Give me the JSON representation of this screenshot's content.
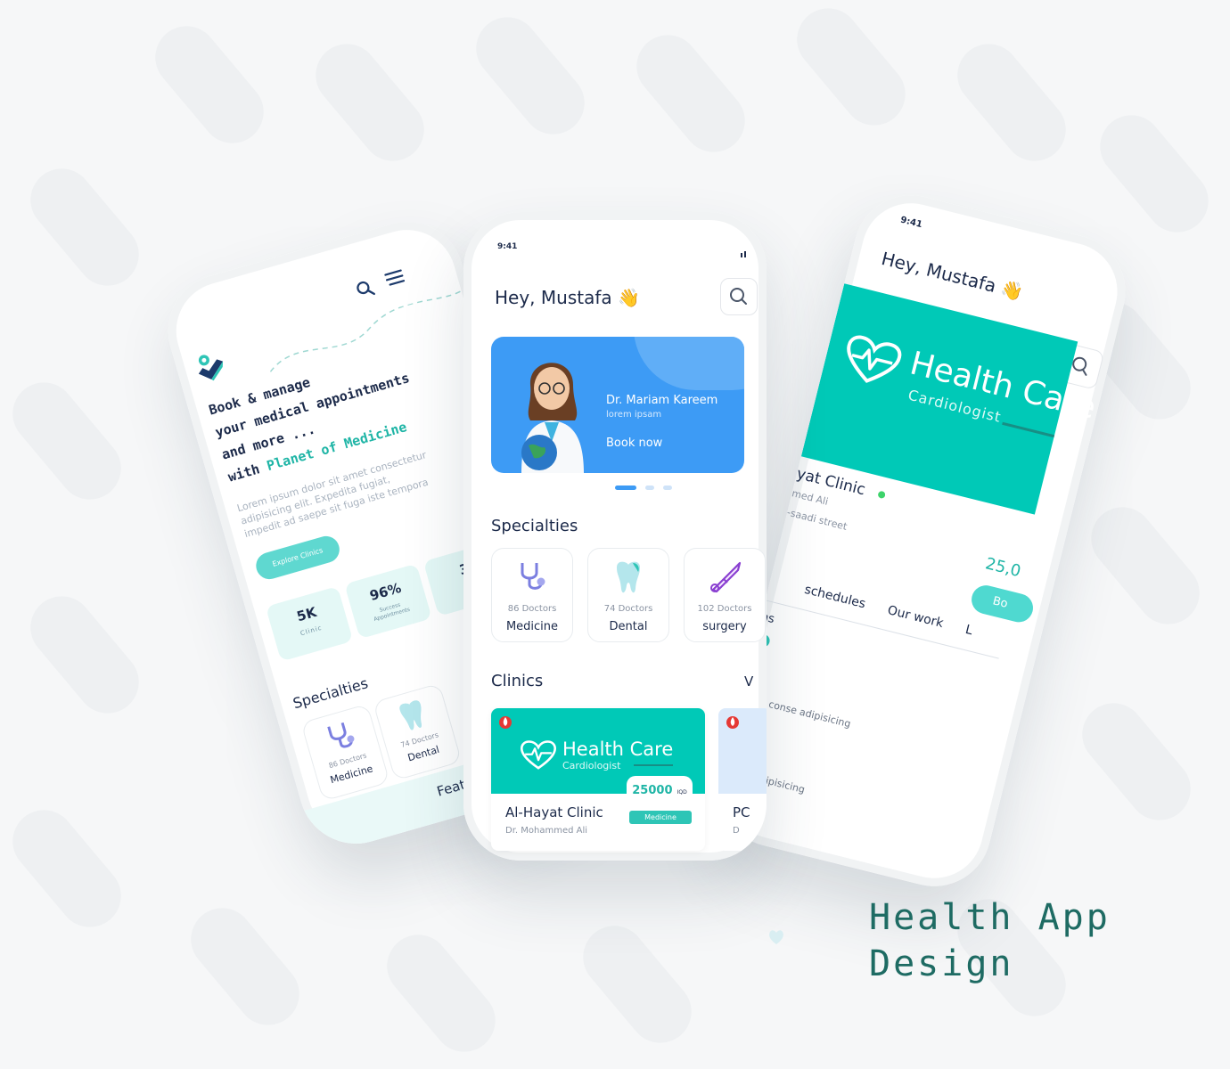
{
  "left_phone": {
    "headline": [
      "Book & manage",
      "your medical appointments",
      "and more ..."
    ],
    "headline_with": "with",
    "headline_brand": "Planet of Medicine",
    "body_lines": [
      "Lorem ipsum dolor sit amet consectetur",
      "adipisicing elit. Expedita fugiat,",
      "impedit ad saepe sit fuga iste tempora"
    ],
    "cta_label": "Explore Clinics",
    "stats": [
      {
        "value": "5K",
        "label": "Clinic"
      },
      {
        "value": "96%",
        "label": "Success Appointments"
      },
      {
        "value": "3",
        "label": ""
      }
    ],
    "specialties_title": "Specialties",
    "specialties": [
      {
        "count": "86 Doctors",
        "name": "Medicine"
      },
      {
        "count": "74 Doctors",
        "name": "Dental"
      }
    ],
    "footer_label": "Features &"
  },
  "center_phone": {
    "time": "9:41",
    "greeting": "Hey, Mustafa",
    "wave": "👋",
    "banner": {
      "doctor": "Dr. Mariam Kareem",
      "subtitle": "lorem ipsam",
      "cta": "Book now"
    },
    "specialties_title": "Specialties",
    "specialties": [
      {
        "count": "86 Doctors",
        "name": "Medicine",
        "icon": "stethoscope-icon"
      },
      {
        "count": "74 Doctors",
        "name": "Dental",
        "icon": "tooth-icon"
      },
      {
        "count": "102 Doctors",
        "name": "surgery",
        "icon": "scalpel-icon"
      }
    ],
    "clinics_title": "Clinics",
    "clinics_view": "V",
    "clinic_card": {
      "brand": "Health Care",
      "brand_sub": "Cardiologist",
      "price": "25000",
      "currency": "IQD",
      "name": "Al-Hayat Clinic",
      "doctor": "Dr. Mohammed Ali",
      "tag": "Medicine"
    },
    "clinic_card_2": {
      "name": "PC",
      "doctor": "D"
    }
  },
  "right_phone": {
    "time": "9:41",
    "greeting": "Hey, Mustafa",
    "wave": "👋",
    "brand": "Health Care",
    "brand_sub": "Cardiologist",
    "clinic_name": "yat Clinic",
    "doctor": "med Ali",
    "address": "-saadi street",
    "price": "25,0",
    "book_label": "Bo",
    "tabs": [
      "schedules",
      "Our work",
      "L"
    ],
    "section_label": "ns",
    "line1": "amet conse adipisicing",
    "line2": "conse adipisicing"
  },
  "caption": {
    "line1": "Health App",
    "line2": "Design"
  },
  "colors": {
    "teal": "#00c9b7",
    "blue": "#3d9bf5",
    "navy": "#1c2a4a",
    "caption": "#1e6b63"
  }
}
